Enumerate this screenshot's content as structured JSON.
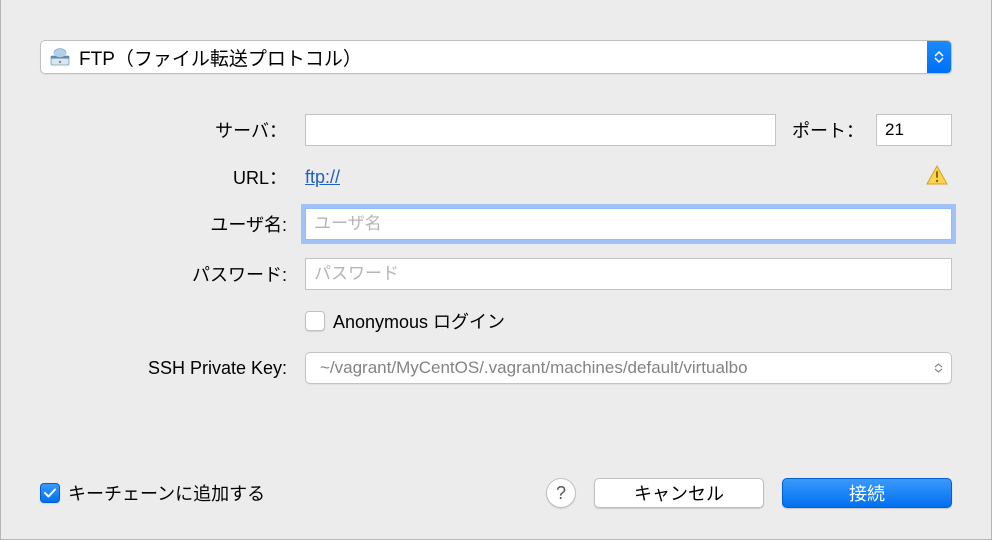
{
  "protocol": {
    "label": "FTP（ファイル転送プロトコル）"
  },
  "labels": {
    "server": "サーバ：",
    "port": "ポート：",
    "url": "URL：",
    "username": "ユーザ名:",
    "password": "パスワード:",
    "ssh_key": "SSH Private Key:"
  },
  "fields": {
    "server": "",
    "port": "21",
    "url_value": "ftp://",
    "username_placeholder": "ユーザ名",
    "password_placeholder": "パスワード",
    "anonymous_label": "Anonymous ログイン",
    "ssh_key_value": "~/vagrant/MyCentOS/.vagrant/machines/default/virtualbo"
  },
  "bottom": {
    "keychain_label": "キーチェーンに追加する",
    "help": "?",
    "cancel": "キャンセル",
    "connect": "接続"
  }
}
